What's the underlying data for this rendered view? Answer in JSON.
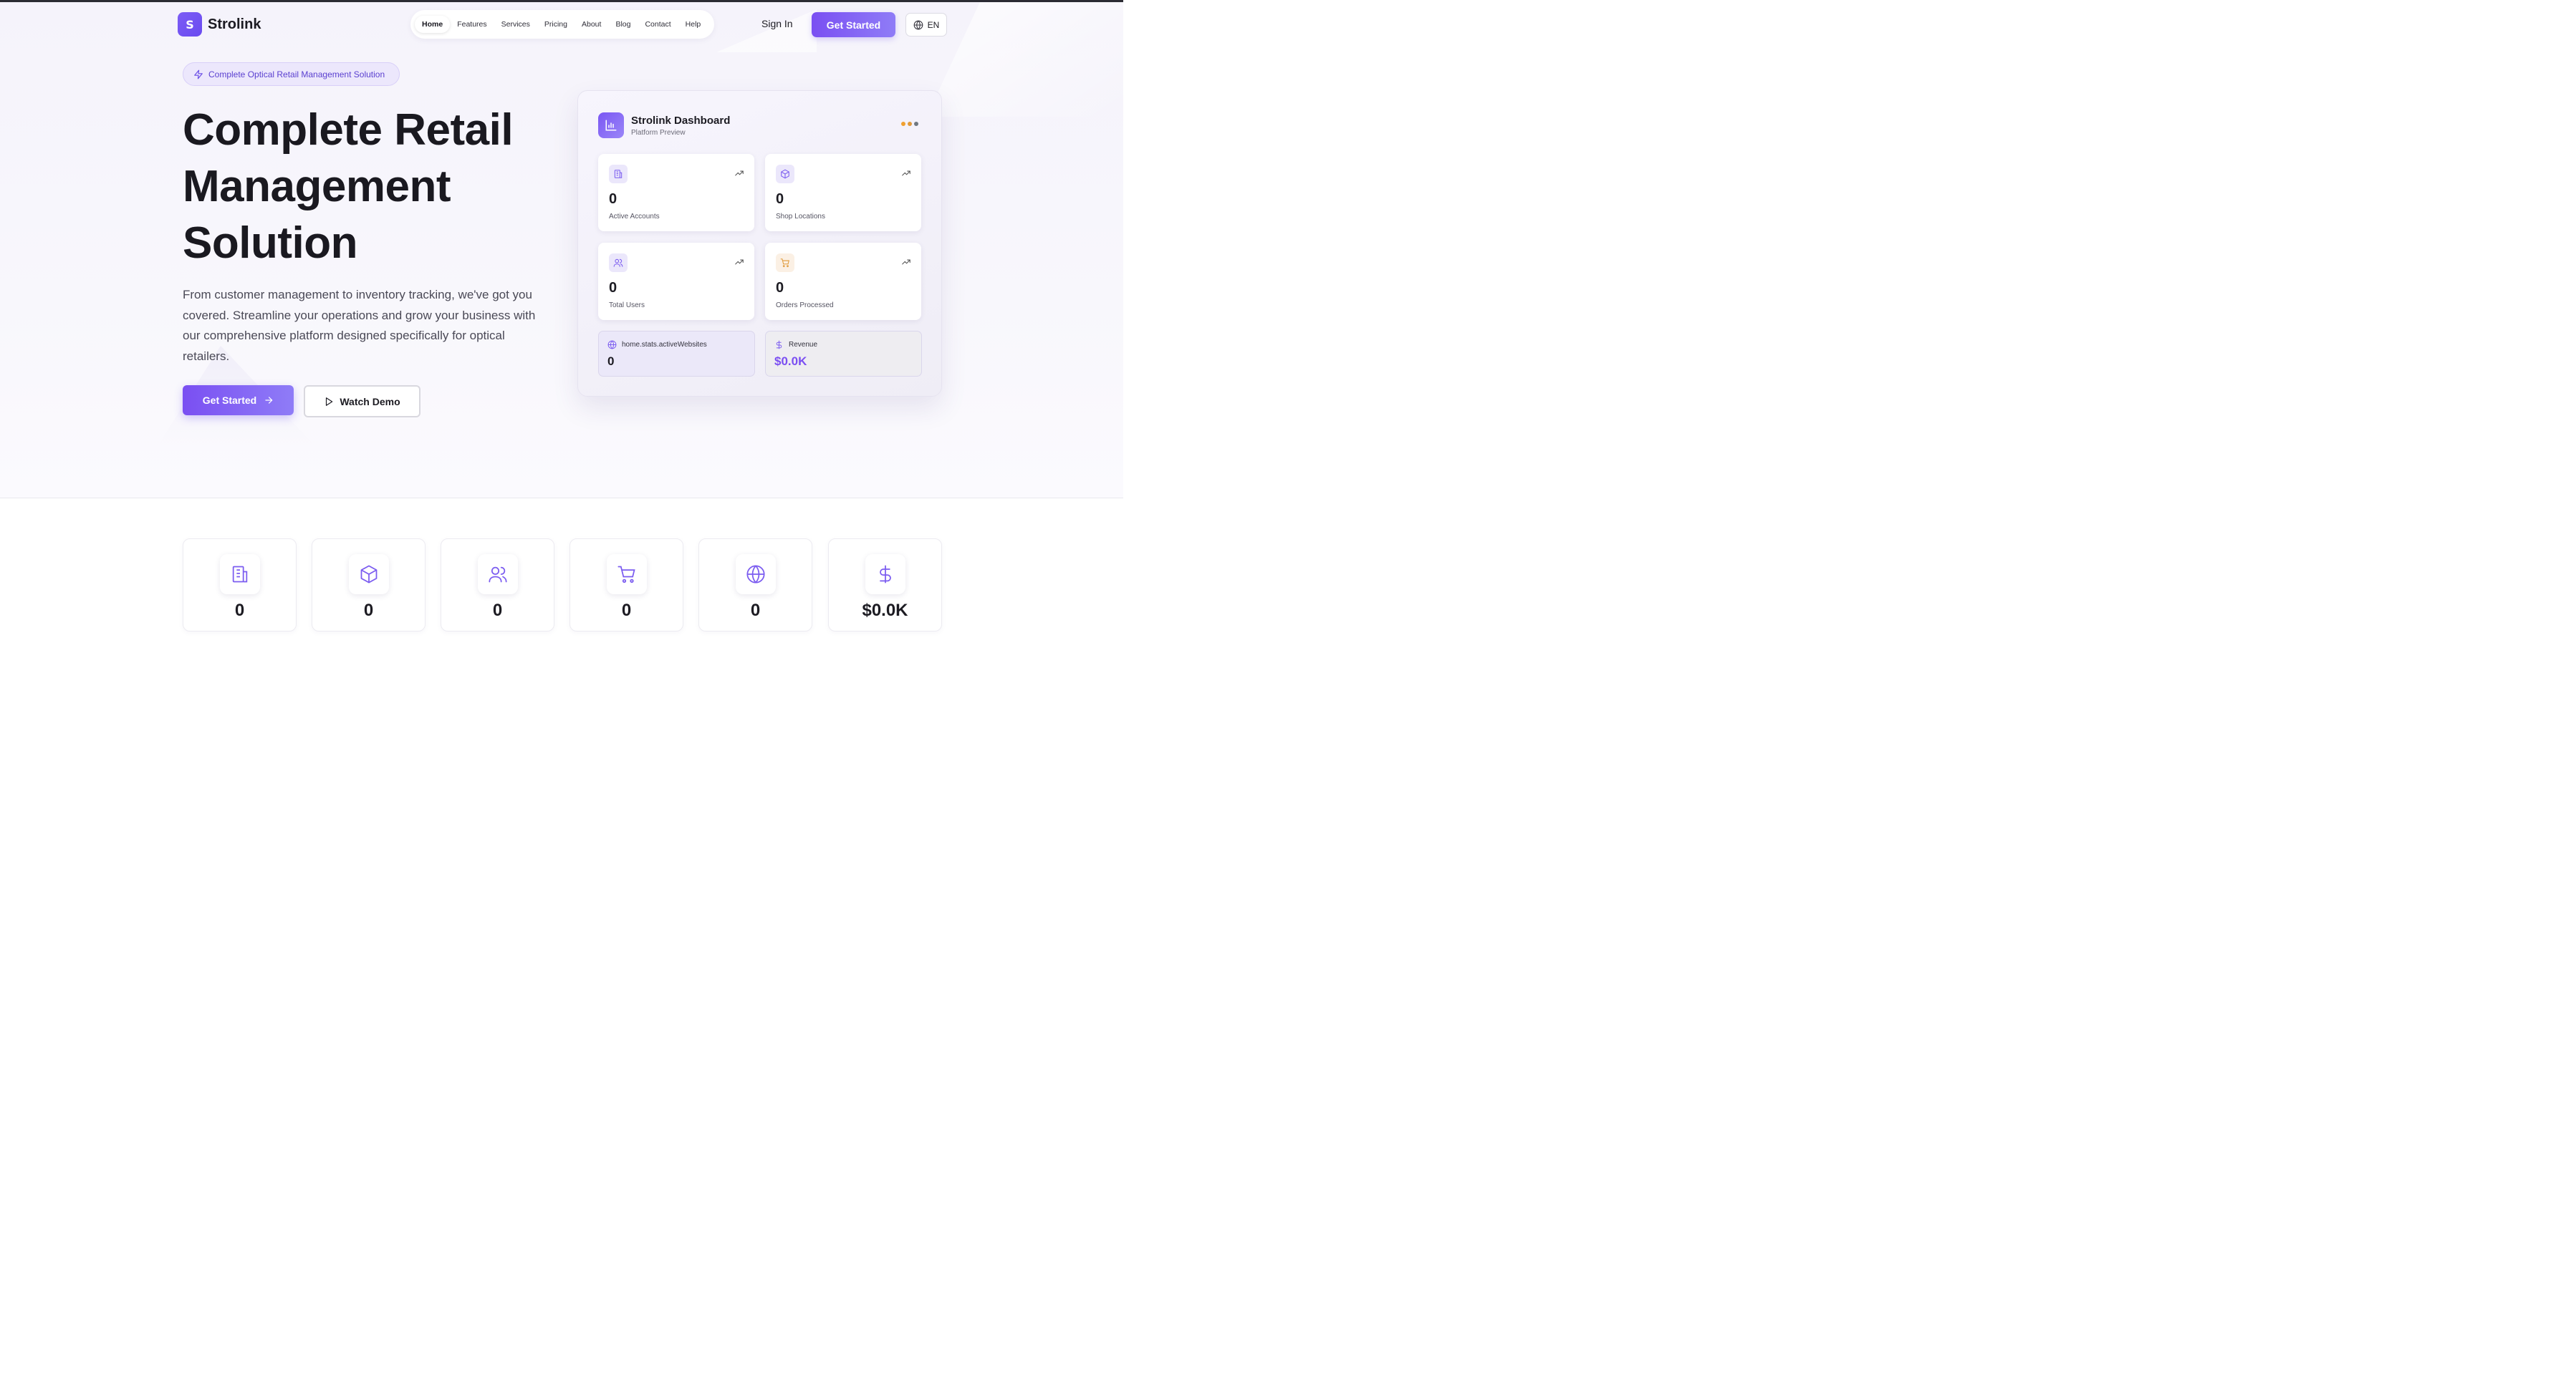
{
  "header": {
    "logo_letter": "S",
    "brand": "Strolink",
    "nav": [
      "Home",
      "Features",
      "Services",
      "Pricing",
      "About",
      "Blog",
      "Contact",
      "Help"
    ],
    "active_nav": "Home",
    "sign_in": "Sign In",
    "get_started": "Get Started",
    "language": "EN"
  },
  "hero": {
    "badge": "Complete Optical Retail Management Solution",
    "title_lines": [
      "Complete Retail",
      "Management",
      "Solution"
    ],
    "description": "From customer management to inventory tracking, we've got you covered. Streamline your operations and grow your business with our comprehensive platform designed specifically for optical retailers.",
    "cta_primary": "Get Started",
    "cta_secondary": "Watch Demo"
  },
  "dashboard": {
    "title": "Strolink Dashboard",
    "subtitle": "Platform Preview",
    "dot_colors": [
      "#f0a030",
      "#e09a3a",
      "#707880"
    ],
    "stats": [
      {
        "icon": "building-icon",
        "value": "0",
        "label": "Active Accounts"
      },
      {
        "icon": "package-icon",
        "value": "0",
        "label": "Shop Locations"
      },
      {
        "icon": "users-icon",
        "value": "0",
        "label": "Total Users"
      },
      {
        "icon": "cart-icon",
        "value": "0",
        "label": "Orders Processed"
      }
    ],
    "mini": [
      {
        "icon": "globe-icon",
        "label": "home.stats.activeWebsites",
        "value": "0"
      },
      {
        "icon": "dollar-icon",
        "label": "Revenue",
        "value": "$0.0K"
      }
    ]
  },
  "stats_strip": [
    {
      "icon": "building-icon",
      "value": "0"
    },
    {
      "icon": "package-icon",
      "value": "0"
    },
    {
      "icon": "users-icon",
      "value": "0"
    },
    {
      "icon": "cart-icon",
      "value": "0"
    },
    {
      "icon": "globe-icon",
      "value": "0"
    },
    {
      "icon": "dollar-icon",
      "value": "$0.0K"
    }
  ],
  "colors": {
    "accent": "#7b4ff2",
    "accent_light": "#ece7fc"
  }
}
